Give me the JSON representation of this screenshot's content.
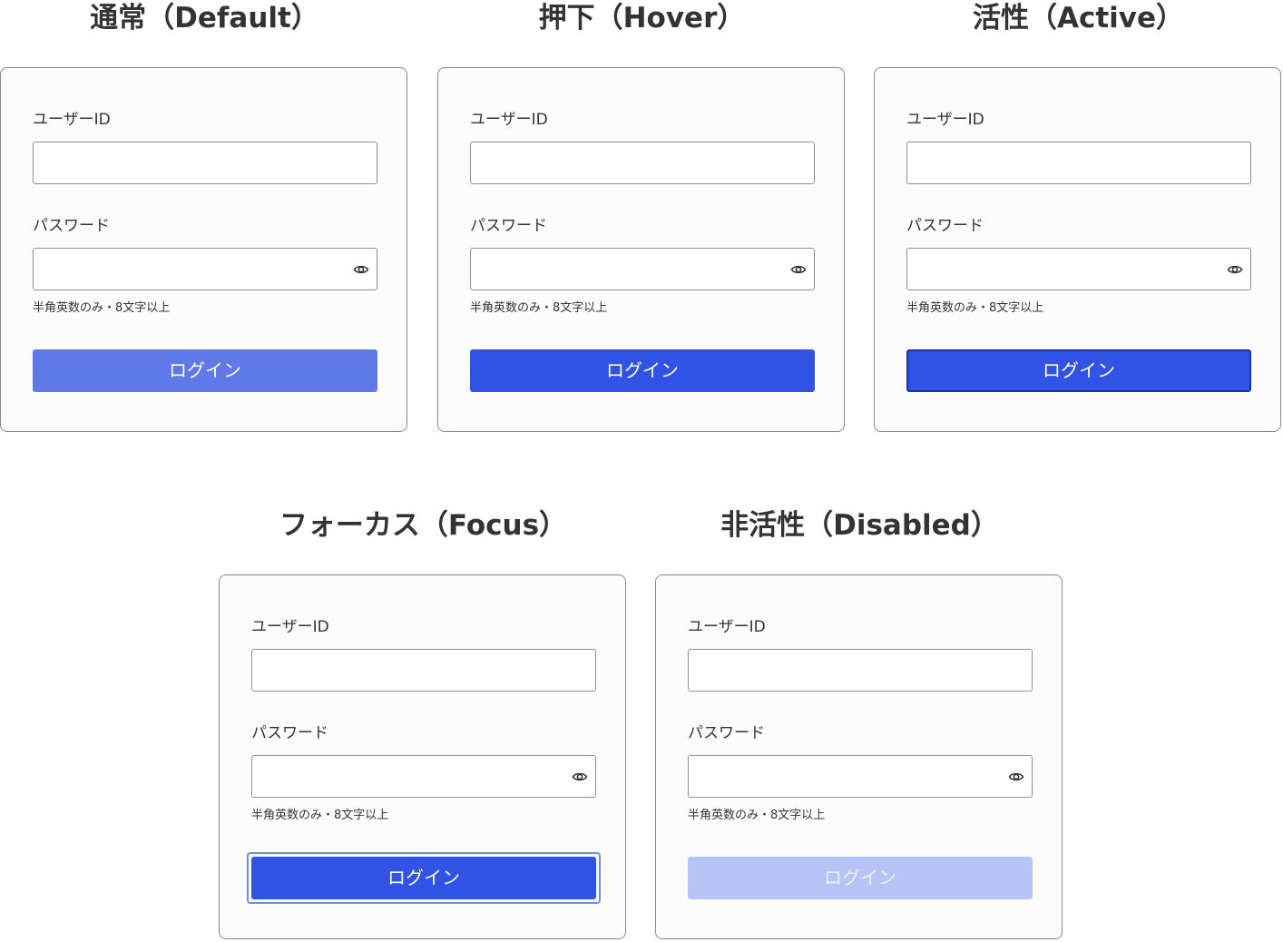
{
  "states": {
    "default": {
      "title": "通常（Default）"
    },
    "hover": {
      "title": "押下（Hover）"
    },
    "active": {
      "title": "活性（Active）"
    },
    "focus": {
      "title": "フォーカス（Focus）"
    },
    "disabled": {
      "title": "非活性（Disabled）"
    }
  },
  "form": {
    "user_id_label": "ユーザーID",
    "user_id_value": "",
    "password_label": "パスワード",
    "password_value": "",
    "password_hint": "半角英数のみ・8文字以上",
    "login_label": "ログイン",
    "toggle_icon": "eye-icon"
  },
  "colors": {
    "default_button": "#5f79e8",
    "hover_button": "#3053e5",
    "active_button": "#3053e5",
    "active_border": "#1634b4",
    "focus_ring": "#6d8cf0",
    "disabled_button": "#b7c3f6"
  }
}
